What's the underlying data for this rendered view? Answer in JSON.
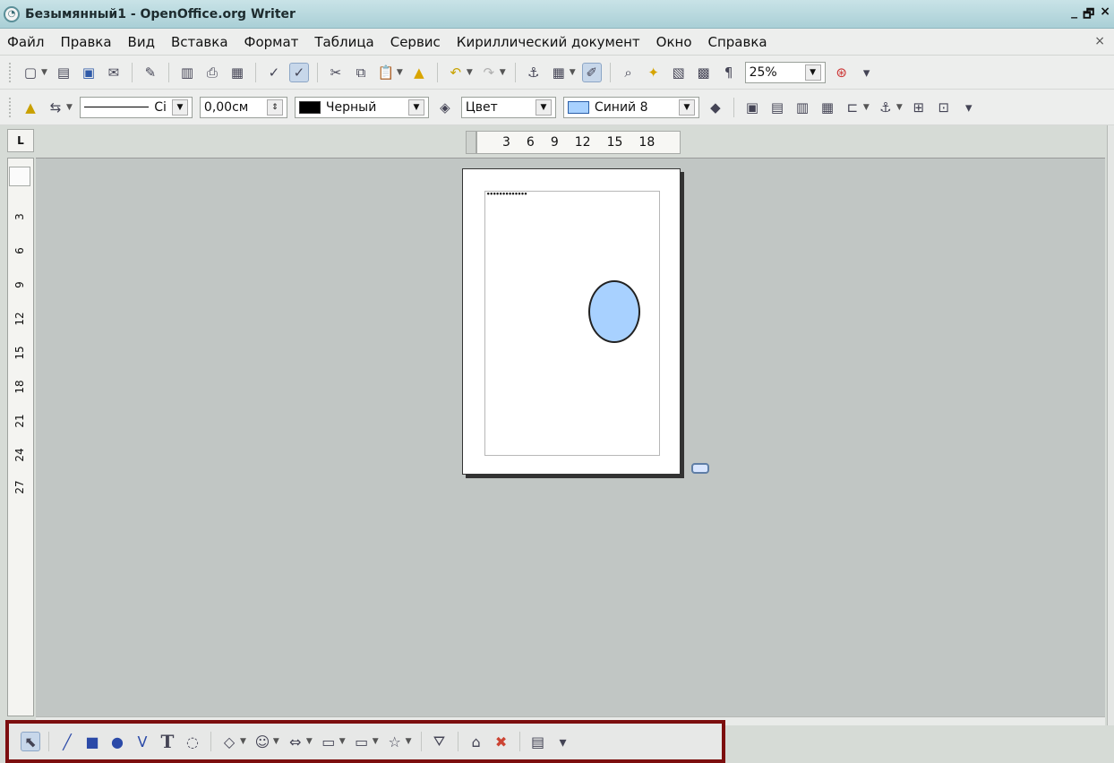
{
  "window": {
    "title": "Безымянный1 - OpenOffice.org Writer",
    "controls": [
      "_",
      "🗗",
      "×"
    ]
  },
  "menubar": {
    "items": [
      "Файл",
      "Правка",
      "Вид",
      "Вставка",
      "Формат",
      "Таблица",
      "Сервис",
      "Кириллический документ",
      "Окно",
      "Справка"
    ],
    "close": "×"
  },
  "toolbar1": {
    "zoom_value": "25%"
  },
  "toolbar2": {
    "line_style_label": "Сі",
    "line_width_value": "0,00см",
    "line_color_label": "Черный",
    "area_style_label": "Цвет",
    "area_color_label": "Синий 8",
    "colors": {
      "line_color": "#000000",
      "area_color": "#a8d1ff"
    }
  },
  "rulers": {
    "horizontal_ticks": [
      "3",
      "6",
      "9",
      "12",
      "15",
      "18"
    ],
    "vertical_ticks": [
      "3",
      "6",
      "9",
      "12",
      "15",
      "18",
      "21",
      "24",
      "27"
    ],
    "corner_label": "L"
  },
  "page": {
    "header_text": "•••••••••••••"
  },
  "drawbar": {
    "tools": [
      "select",
      "line",
      "rectangle",
      "ellipse",
      "curve",
      "text",
      "callout",
      "shapes",
      "symbol-shapes",
      "arrows",
      "flowchart",
      "callouts",
      "stars",
      "points",
      "fontwork",
      "gallery",
      "extrusion"
    ]
  }
}
